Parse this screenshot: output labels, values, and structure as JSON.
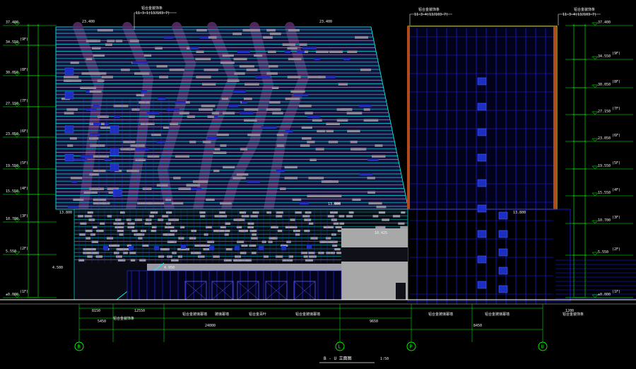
{
  "drawing": {
    "title": "B - U 立面图",
    "scale": "1:50"
  },
  "axes": [
    "B",
    "L",
    "P",
    "U"
  ],
  "levels_left": [
    {
      "elev": "37.400",
      "tag": ""
    },
    {
      "elev": "34.550",
      "tag": "(9F)"
    },
    {
      "elev": "30.050",
      "tag": "(8F)"
    },
    {
      "elev": "27.150",
      "tag": "(7F)"
    },
    {
      "elev": "23.050",
      "tag": "(6F)"
    },
    {
      "elev": "19.550",
      "tag": "(5F)"
    },
    {
      "elev": "15.550",
      "tag": "(4F)"
    },
    {
      "elev": "10.700",
      "tag": "(3F)"
    },
    {
      "elev": "5.550",
      "tag": "(2F)"
    },
    {
      "elev": "±0.000",
      "tag": "(1F)"
    }
  ],
  "levels_right": [
    {
      "elev": "37.400",
      "tag": ""
    },
    {
      "elev": "34.550",
      "tag": "(9F)"
    },
    {
      "elev": "30.050",
      "tag": "(8F)"
    },
    {
      "elev": "27.150",
      "tag": "(7F)"
    },
    {
      "elev": "23.050",
      "tag": "(6F)"
    },
    {
      "elev": "19.550",
      "tag": "(5F)"
    },
    {
      "elev": "15.550",
      "tag": "(4F)"
    },
    {
      "elev": "10.700",
      "tag": "(3F)"
    },
    {
      "elev": "5.550",
      "tag": "(2F)"
    },
    {
      "elev": "±0.000",
      "tag": "(1F)"
    }
  ],
  "annotations_top": [
    {
      "line1": "铝合金装饰条",
      "line2": "11-3-1(13J103-7)"
    },
    {
      "line1": "铝合金装饰条",
      "line2": "11-3-4(13J103-7)"
    },
    {
      "line1": "铝合金装饰条",
      "line2": "11-3-4(13J103-7)"
    }
  ],
  "annotations_bottom": [
    "铝合金装饰条",
    "铝合金玻璃幕墙",
    "玻璃幕墙",
    "铝合金百叶",
    "铝合金玻璃幕墙",
    "铝合金玻璃幕墙",
    "铝合金装饰条"
  ],
  "spot_elevations": [
    "23.400",
    "23.400",
    "13.800",
    "13.800",
    "13.800",
    "10.425",
    "4.500",
    "4.950"
  ],
  "dimensions_bottom": [
    "8150",
    "12550",
    "5450",
    "24000",
    "9650",
    "8450",
    "1200"
  ]
}
